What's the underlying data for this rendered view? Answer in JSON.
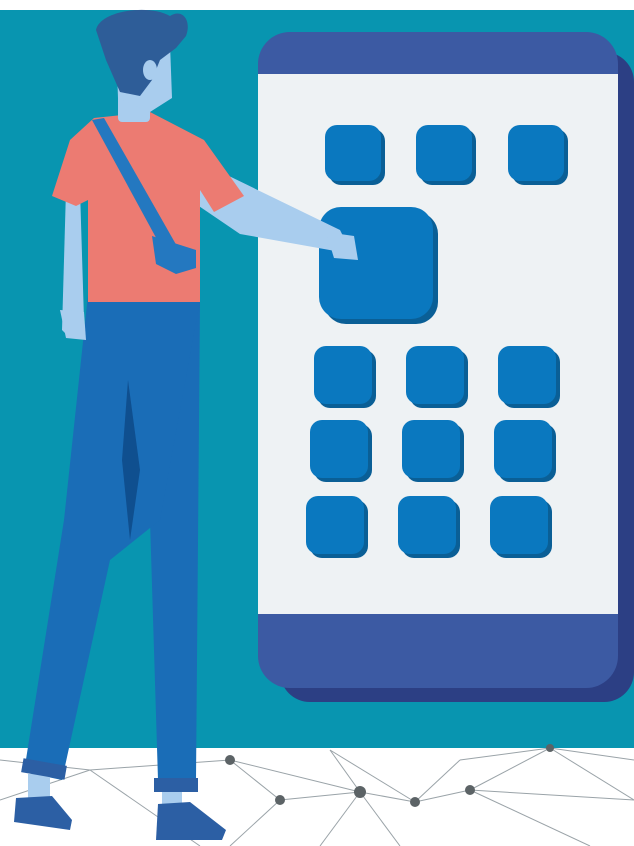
{
  "illustration": {
    "subject": "person-tapping-phone-app-grid",
    "icons": {
      "app": "app-tile-icon",
      "selected_app": "selected-app-tile-icon",
      "network": "network-node-icon"
    },
    "colors": {
      "teal_background": "#0895b0",
      "white_background": "#ffffff",
      "phone_frame": "#3c5aa3",
      "phone_shadow": "#2c3f84",
      "phone_screen": "#eef2f4",
      "app_tile": "#0a78bf",
      "app_tile_shadow": "#0a5f96",
      "shirt": "#ec7b72",
      "skin": "#a9cdee",
      "hair": "#2e5d98",
      "pants": "#1a6db7",
      "pants_shadow": "#0f4f8f",
      "strap": "#2478c0",
      "shoe": "#2c5fa4",
      "network_line": "#9aa3a8",
      "network_node": "#5c6366"
    }
  }
}
